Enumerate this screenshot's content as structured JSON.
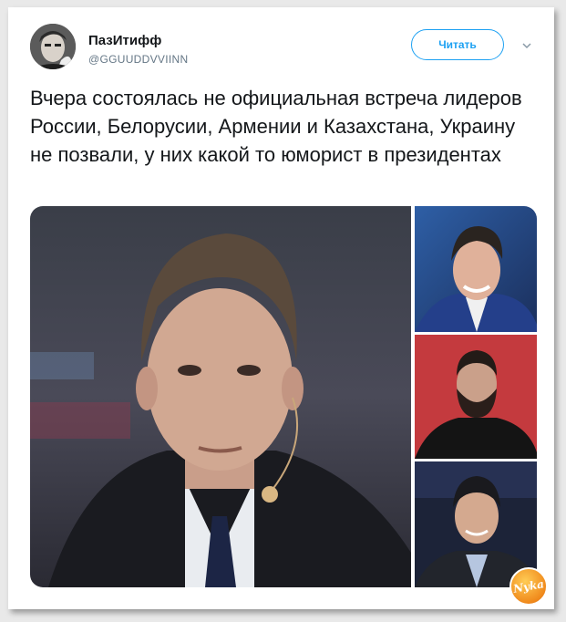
{
  "tweet": {
    "author_name": "ПазИтифф",
    "author_handle": "@GGUUDDVVIINN",
    "follow_label": "Читать",
    "text": "Вчера состоялась не официальная встреча лидеров России, Белорусии, Армении и Казахстана, Украину не позвали, у них какой то юморист в президентах"
  },
  "media": {
    "photos": [
      {
        "subject": "man-in-dark-suit-with-headset-mic"
      },
      {
        "subject": "smiling-man-blue-jacket"
      },
      {
        "subject": "bearded-man-red-background"
      },
      {
        "subject": "smiling-man-suit-with-mic"
      }
    ]
  },
  "watermark": {
    "text": "Nyka"
  },
  "colors": {
    "accent": "#1da1f2",
    "text": "#14171a",
    "muted": "#657786"
  },
  "icons": {
    "menu": "chevron-down-icon"
  }
}
